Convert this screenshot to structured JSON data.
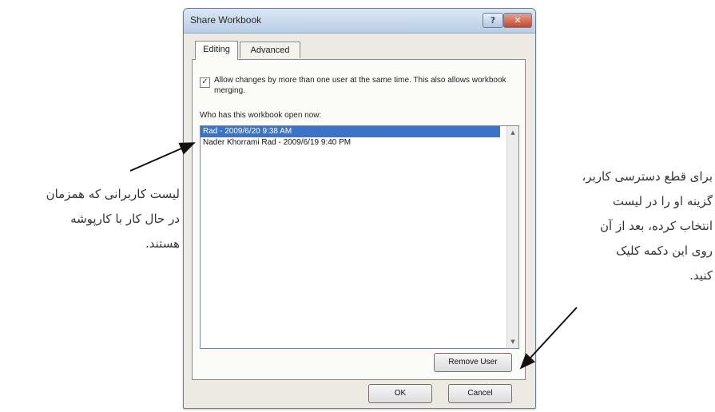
{
  "dialog": {
    "title": "Share Workbook",
    "help_label": "?",
    "close_label": "✕",
    "tabs": [
      {
        "label": "Editing",
        "active": true
      },
      {
        "label": "Advanced",
        "active": false
      }
    ],
    "allow_changes_checked": true,
    "checkbox_mark": "✓",
    "allow_changes_label": "Allow changes by more than one user at the same time. This also allows workbook merging.",
    "who_label": "Who has this workbook open now:",
    "users": [
      {
        "label": "Rad - 2009/6/20 9:38 AM",
        "selected": true
      },
      {
        "label": "Nader Khorrami Rad - 2009/6/19 9:40 PM",
        "selected": false
      }
    ],
    "scroll_up": "▲",
    "scroll_down": "▼",
    "remove_user_label": "Remove User",
    "ok_label": "OK",
    "cancel_label": "Cancel"
  },
  "annotations": {
    "left": [
      "لیست کاربرانی که همزمان",
      "در حال کار با کارپوشه",
      "هستند."
    ],
    "right": [
      "برای قطع دسترسی کاربر،",
      "گزینه او را در لیست",
      "انتخاب کرده، بعد از آن",
      "روی این دکمه کلیک",
      "کنید."
    ]
  },
  "colors": {
    "selection": "#3b73c8",
    "titlebar": "#b9cde4",
    "dialog_bg": "#eceae3"
  }
}
